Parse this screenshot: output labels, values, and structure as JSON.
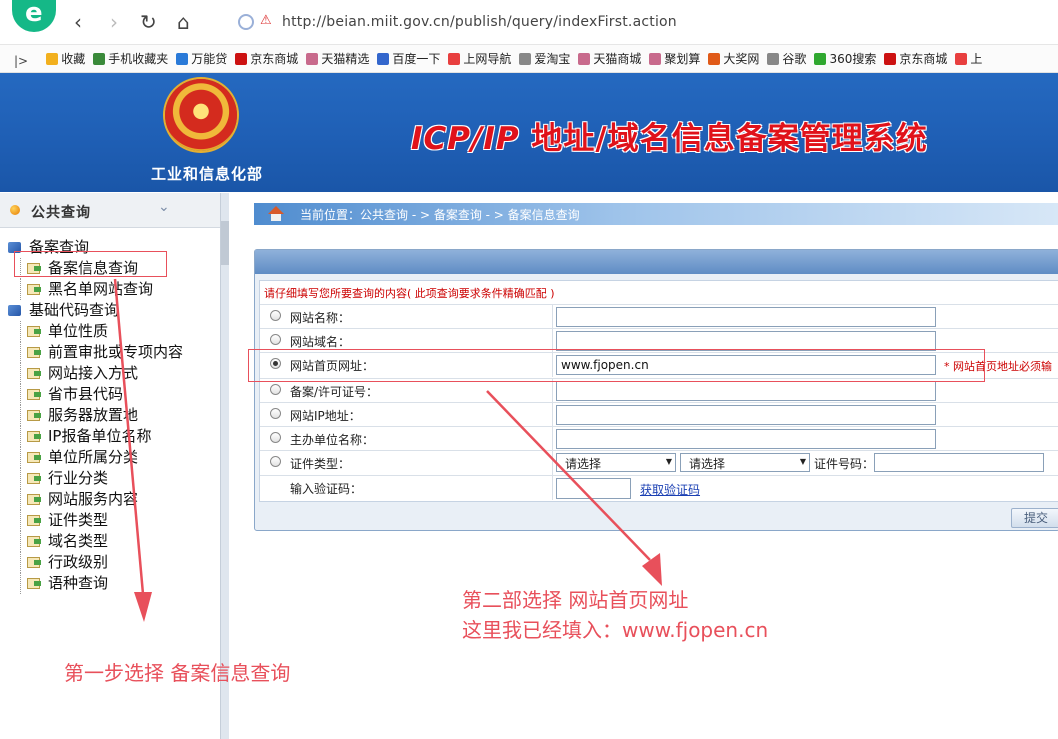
{
  "browser": {
    "url": "http://beian.miit.gov.cn/publish/query/indexFirst.action",
    "bookmarks": [
      "收藏",
      "手机收藏夹",
      "万能贷",
      "京东商城",
      "天猫精选",
      "百度一下",
      "上网导航",
      "爱淘宝",
      "天猫商城",
      "聚划算",
      "大奖网",
      "谷歌",
      "360搜索",
      "京东商城",
      "上"
    ],
    "bookmark_icon_colors": [
      "#f2b01e",
      "#3a8a3a",
      "#2a7ad8",
      "#cc1111",
      "#c86a8c",
      "#3366cc",
      "#e83f3f",
      "#888888",
      "#c86a8c",
      "#c86a8c",
      "#e05a18",
      "#888888",
      "#30a830",
      "#cc1111",
      "#e83f3f"
    ]
  },
  "site": {
    "ministry": "工业和信息化部",
    "title_latin": "ICP/IP",
    "title_cn": " 地址/域名信息备案管理系统"
  },
  "sidebar": {
    "heading": "公共查询",
    "groups": [
      {
        "label": "备案查询",
        "items": [
          "备案信息查询",
          "黑名单网站查询"
        ]
      },
      {
        "label": "基础代码查询",
        "items": [
          "单位性质",
          "前置审批或专项内容",
          "网站接入方式",
          "省市县代码",
          "服务器放置地",
          "IP报备单位名称",
          "单位所属分类",
          "行业分类",
          "网站服务内容",
          "证件类型",
          "域名类型",
          "行政级别",
          "语种查询"
        ]
      }
    ]
  },
  "breadcrumb": {
    "text": "当前位置：公共查询  - >  备案查询  - > 备案信息查询"
  },
  "form": {
    "notice": "请仔细填写您所要查询的内容( 此项查询要求条件精确匹配 )",
    "fields": [
      {
        "label": "网站名称：",
        "value": "",
        "checked": false
      },
      {
        "label": "网站域名：",
        "value": "",
        "checked": false
      },
      {
        "label": "网站首页网址：",
        "value": "www.fjopen.cn",
        "checked": true,
        "hint": "* 网站首页地址必须输"
      },
      {
        "label": "备案/许可证号：",
        "value": "",
        "checked": false
      },
      {
        "label": "网站IP地址：",
        "value": "",
        "checked": false
      },
      {
        "label": "主办单位名称：",
        "value": "",
        "checked": false
      }
    ],
    "cert": {
      "label": "证件类型：",
      "select1": "请选择",
      "select2": "请选择",
      "number_label": "证件号码："
    },
    "captcha": {
      "label": "输入验证码：",
      "link": "获取验证码"
    },
    "submit": "提交"
  },
  "annotations": {
    "step1": "第一步选择  备案信息查询",
    "step2_line1": "第二部选择  网站首页网址",
    "step2_line2": "这里我已经填入：www.fjopen.cn",
    "color": "#e8505b"
  }
}
